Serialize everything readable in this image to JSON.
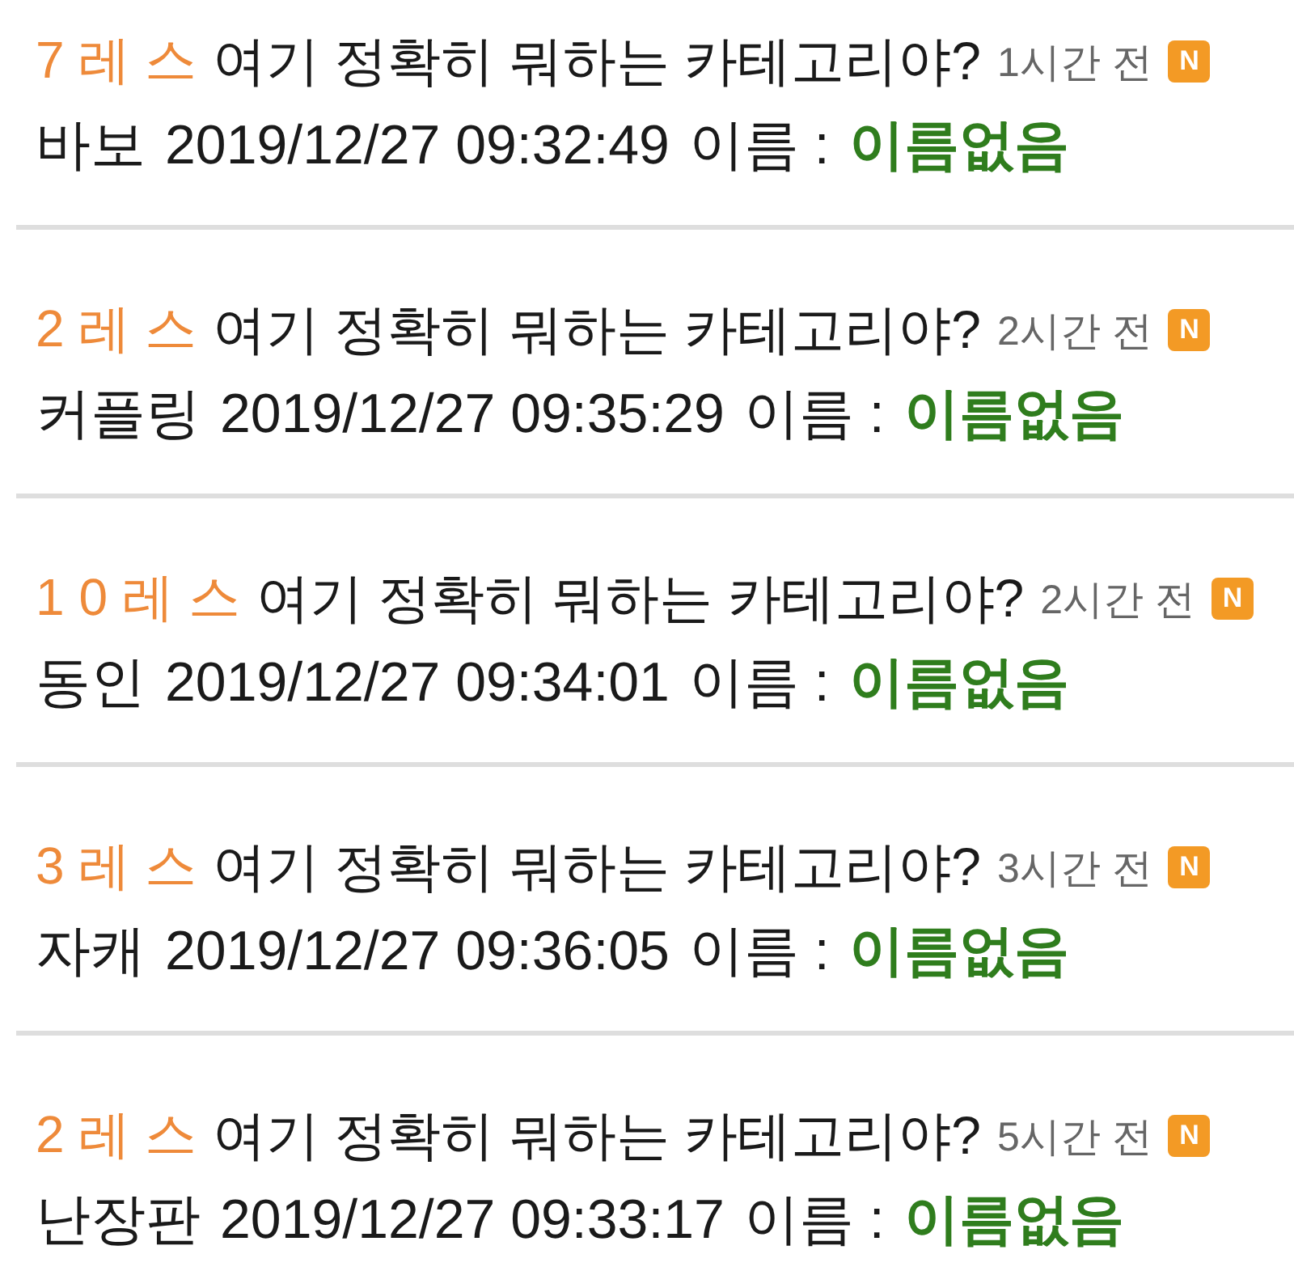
{
  "posts": [
    {
      "reply_count": "7 레 스",
      "title": "여기 정확히 뭐하는 카테고리야?",
      "time_ago": "1시간 전",
      "badge": "N",
      "board": "바보",
      "date": "2019/12/27 09:32:49",
      "name_label": "이름 :",
      "name": "이름없음"
    },
    {
      "reply_count": "2 레 스",
      "title": "여기 정확히 뭐하는 카테고리야?",
      "time_ago": "2시간 전",
      "badge": "N",
      "board": "커플링",
      "date": "2019/12/27 09:35:29",
      "name_label": "이름 :",
      "name": "이름없음"
    },
    {
      "reply_count": "1 0 레 스",
      "title": "여기 정확히 뭐하는 카테고리야?",
      "time_ago": "2시간 전",
      "badge": "N",
      "board": "동인",
      "date": "2019/12/27 09:34:01",
      "name_label": "이름 :",
      "name": "이름없음"
    },
    {
      "reply_count": "3 레 스",
      "title": "여기 정확히 뭐하는 카테고리야?",
      "time_ago": "3시간 전",
      "badge": "N",
      "board": "자캐",
      "date": "2019/12/27 09:36:05",
      "name_label": "이름 :",
      "name": "이름없음"
    },
    {
      "reply_count": "2 레 스",
      "title": "여기 정확히 뭐하는 카테고리야?",
      "time_ago": "5시간 전",
      "badge": "N",
      "board": "난장판",
      "date": "2019/12/27 09:33:17",
      "name_label": "이름 :",
      "name": "이름없음"
    }
  ]
}
